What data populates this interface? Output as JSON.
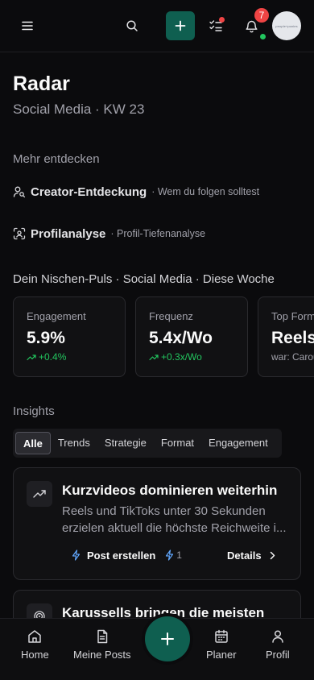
{
  "topbar": {
    "notification_count": "7",
    "avatar_text": "people+ponies"
  },
  "header": {
    "title": "Radar",
    "subtitle": "Social Media · KW 23"
  },
  "discover": {
    "heading": "Mehr entdecken",
    "items": [
      {
        "title": "Creator-Entdeckung",
        "subtitle": "· Wem du folgen solltest",
        "icon": "user-search-icon"
      },
      {
        "title": "Profilanalyse",
        "subtitle": "· Profil-Tiefenanalyse",
        "icon": "scan-face-icon"
      }
    ]
  },
  "pulse": {
    "heading": "Dein Nischen-Puls · Social Media · Diese Woche",
    "cards": [
      {
        "label": "Engagement",
        "value": "5.9%",
        "delta": "+0.4%"
      },
      {
        "label": "Frequenz",
        "value": "5.4x/Wo",
        "delta": "+0.3x/Wo"
      },
      {
        "label": "Top Format",
        "value": "Reels",
        "was": "war: Carousel"
      }
    ]
  },
  "insights": {
    "heading": "Insights",
    "tabs": [
      "Alle",
      "Trends",
      "Strategie",
      "Format",
      "Engagement"
    ],
    "active_tab": "Alle",
    "cards": [
      {
        "title": "Kurzvideos dominieren weiterhin",
        "body": "Reels und TikToks unter 30 Sekunden erzielen aktuell die höchste Reichweite i...",
        "action": "Post erstellen",
        "count": "1",
        "details": "Details",
        "icon": "trending-up-icon"
      },
      {
        "title": "Karussells bringen die meisten",
        "icon": "target-icon"
      }
    ]
  },
  "nav": {
    "items": [
      "Home",
      "Meine Posts",
      "Planer",
      "Profil"
    ]
  },
  "colors": {
    "background": "#0b0b0d",
    "accent": "#0f5f50",
    "positive": "#22c55e",
    "badge": "#ef4444"
  }
}
